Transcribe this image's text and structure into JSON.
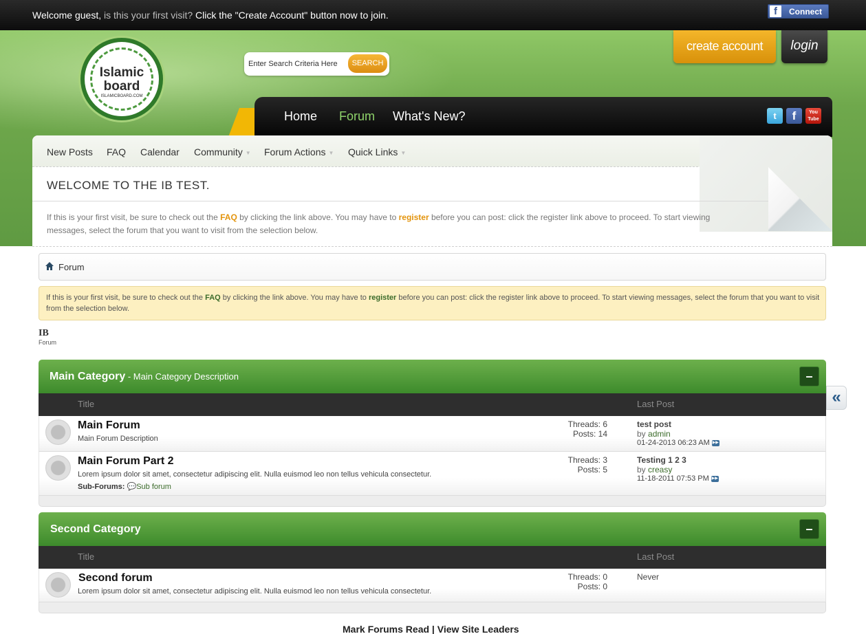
{
  "topbar": {
    "welcome_strong": "Welcome guest,",
    "welcome_gray": " is this your first visit?",
    "welcome_cta": " Click the \"Create Account\" button now to join.",
    "fb_connect_label": "Connect"
  },
  "logo": {
    "line1": "Islamic",
    "line2": "board",
    "line3": "ISLAMICBOARD.COM"
  },
  "search": {
    "placeholder": "Enter Search Criteria Here",
    "button_label": "SEARCH"
  },
  "auth": {
    "create_account_label": "create account",
    "login_label": "login"
  },
  "main_nav": {
    "home": "Home",
    "forum": "Forum",
    "whats_new": "What's New?"
  },
  "social": {
    "twitter": "t",
    "facebook": "f",
    "youtube_you": "You",
    "youtube_tube": "Tube"
  },
  "sub_nav": {
    "new_posts": "New Posts",
    "faq": "FAQ",
    "calendar": "Calendar",
    "community": "Community",
    "forum_actions": "Forum Actions",
    "quick_links": "Quick Links"
  },
  "welcome_box": {
    "title": "WELCOME TO THE IB TEST.",
    "text_1": "If this is your first visit, be sure to check out the ",
    "faq_link": "FAQ",
    "text_2": " by clicking the link above. You may have to ",
    "register_link": "register",
    "text_3": " before you can post: click the register link above to proceed. To start viewing messages, select the forum that you want to visit from the selection below."
  },
  "breadcrumb": {
    "label": "Forum"
  },
  "notice": {
    "text_1": "If this is your first visit, be sure to check out the ",
    "faq_link": "FAQ",
    "text_2": " by clicking the link above. You may have to ",
    "register_link": "register",
    "text_3": " before you can post: click the register link above to proceed. To start viewing messages, select the forum that you want to visit from the selection below."
  },
  "site_heading": {
    "title": "IB",
    "subtitle": "Forum"
  },
  "categories": [
    {
      "title": "Main Category",
      "description": " - Main Category Description",
      "collapse_label": "–",
      "col_title": "Title",
      "col_last_post": "Last Post",
      "forums": [
        {
          "title": "Main Forum",
          "description": "Main Forum Description",
          "threads": "Threads: 6",
          "posts": "Posts: 14",
          "last_post_title": "test post",
          "last_post_by": "by ",
          "last_post_user": "admin",
          "last_post_date": "01-24-2013 06:23 AM"
        },
        {
          "title": "Main Forum Part 2",
          "description": "Lorem ipsum dolor sit amet, consectetur adipiscing elit. Nulla euismod leo non tellus vehicula consectetur.",
          "subforums_label": "Sub-Forums:",
          "subforum": "Sub forum",
          "threads": "Threads: 3",
          "posts": "Posts: 5",
          "last_post_title": "Testing 1 2 3",
          "last_post_by": "by ",
          "last_post_user": "creasy",
          "last_post_date": "11-18-2011 07:53 PM"
        }
      ]
    },
    {
      "title": "Second Category",
      "collapse_label": "–",
      "col_title": "Title",
      "col_last_post": "Last Post",
      "forums": [
        {
          "title": "Second forum",
          "description": "Lorem ipsum dolor sit amet, consectetur adipiscing elit. Nulla euismod leo non tellus vehicula consectetur.",
          "threads": "Threads: 0",
          "posts": "Posts: 0",
          "last_post_title": "Never"
        }
      ]
    }
  ],
  "side_tab": {
    "label": "«"
  },
  "footer": {
    "mark_read": "Mark Forums Read",
    "separator": " | ",
    "site_leaders": "View Site Leaders"
  },
  "colors": {
    "accent_orange": "#f2a51c",
    "brand_green": "#4e9a36",
    "link_green": "#3b6b2a",
    "notice_yellow": "#fdf0c1"
  },
  "icons": {
    "home": "home-icon",
    "status": "forum-status-icon",
    "goto": "goto-last-post-icon",
    "subforum": "speech-bubble-icon",
    "collapse": "collapse-icon",
    "side_tab": "double-chevron-left-icon"
  }
}
